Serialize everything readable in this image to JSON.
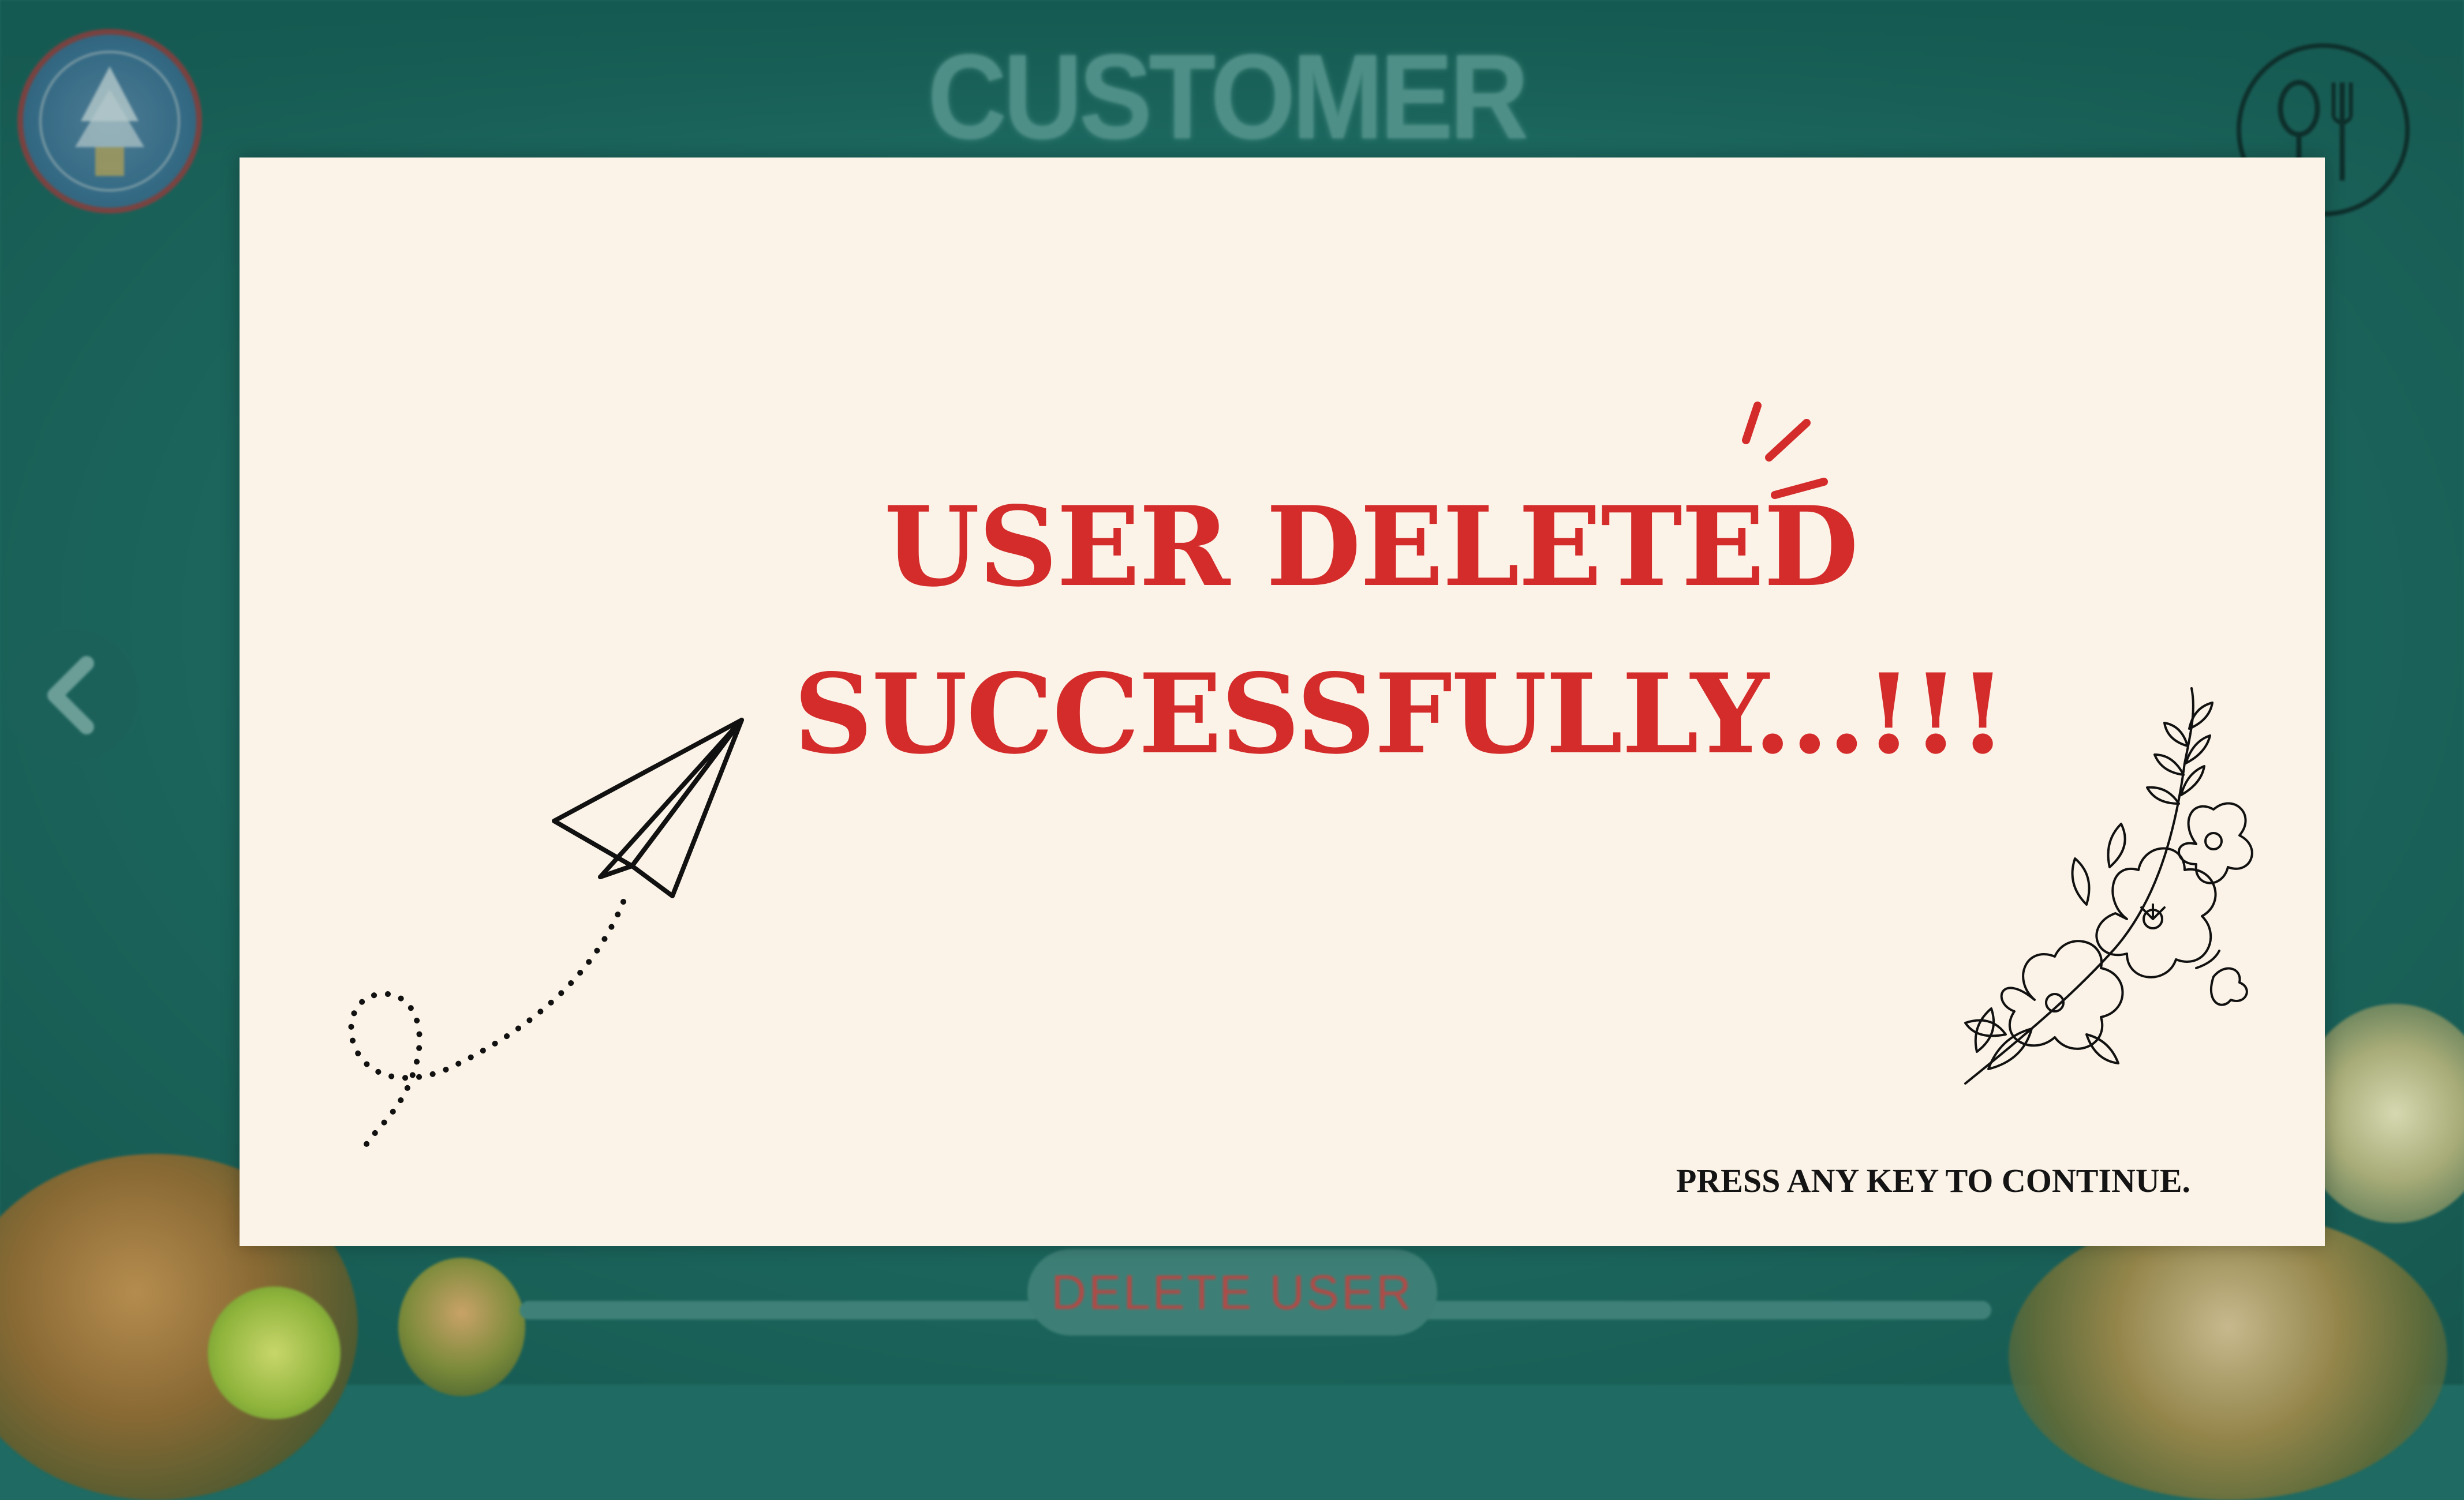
{
  "background": {
    "title": "CUSTOMER ACCOUNT",
    "delete_button_label": "DELETE USER",
    "logo_icon": "college-logo-icon",
    "menu_icon": "fork-spoon-icon",
    "back_icon": "chevron-left-icon"
  },
  "dialog": {
    "message_line1": "USER DELETED",
    "message_line2": "SUCCESSFULLY...!!!",
    "hint": "PRESS ANY KEY TO CONTINUE."
  },
  "colors": {
    "accent_red": "#d42b2b",
    "dialog_bg": "#fbf3e7",
    "screen_teal": "#1f6a62"
  }
}
